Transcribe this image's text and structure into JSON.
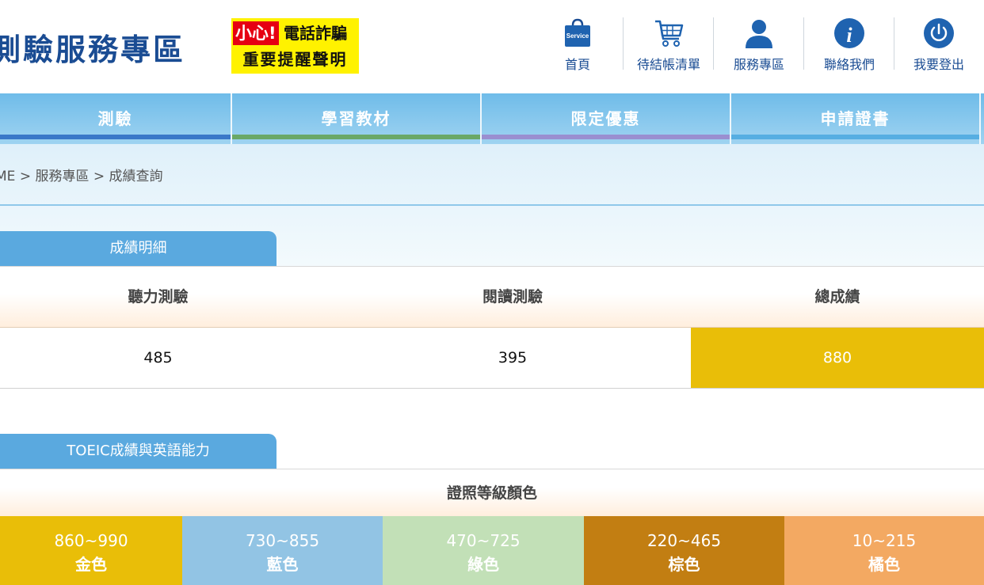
{
  "header": {
    "site_title": "測驗服務專區",
    "warning": {
      "red_text": "小心!",
      "line1_rest": "電話詐騙",
      "line2": "重要提醒聲明"
    },
    "nav": [
      {
        "label": "首頁",
        "icon": "shopping-bag-service-icon",
        "badge": "Service"
      },
      {
        "label": "待結帳清單",
        "icon": "shopping-cart-icon"
      },
      {
        "label": "服務專區",
        "icon": "user-icon"
      },
      {
        "label": "聯絡我們",
        "icon": "info-icon"
      },
      {
        "label": "我要登出",
        "icon": "power-icon"
      }
    ]
  },
  "main_nav": [
    {
      "label": "測驗",
      "color": "#3a78c8"
    },
    {
      "label": "學習教材",
      "color": "#6aa868"
    },
    {
      "label": "限定優惠",
      "color": "#9a8fd0"
    },
    {
      "label": "申請證書",
      "color": "#56aee2"
    }
  ],
  "breadcrumb": "ME > 服務專區 > 成績查詢",
  "score_section": {
    "tab": "成績明細",
    "headers": [
      "聽力測驗",
      "閱讀測驗",
      "總成績"
    ],
    "values": [
      "485",
      "395",
      "880"
    ],
    "total_color": "#e9be08"
  },
  "grade_section": {
    "tab": "TOEIC成績與英語能力",
    "header": "證照等級顏色",
    "grades": [
      {
        "range": "860~990",
        "name": "金色",
        "color": "#e9be08"
      },
      {
        "range": "730~855",
        "name": "藍色",
        "color": "#92c4e4"
      },
      {
        "range": "470~725",
        "name": "綠色",
        "color": "#c2e0b7"
      },
      {
        "range": "220~465",
        "name": "棕色",
        "color": "#c27e12"
      },
      {
        "range": "10~215",
        "name": "橘色",
        "color": "#f3a962"
      }
    ]
  },
  "colors": {
    "brand_blue": "#1a4c93",
    "tab_blue": "#5aa9df"
  }
}
